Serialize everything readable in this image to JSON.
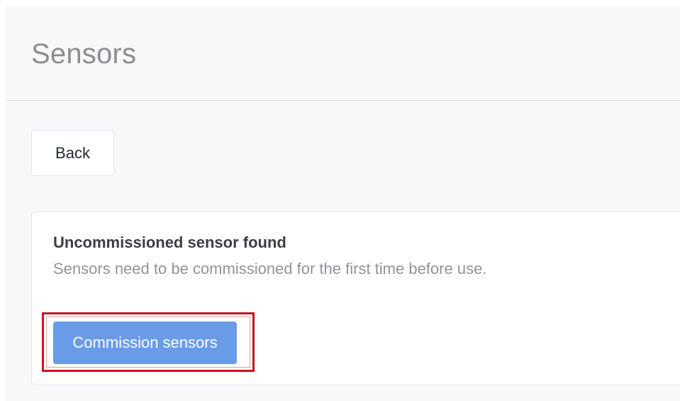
{
  "header": {
    "title": "Sensors"
  },
  "actions": {
    "back_label": "Back"
  },
  "notice": {
    "title": "Uncommissioned sensor found",
    "description": "Sensors need to be commissioned for the first time before use.",
    "button_label": "Commission sensors",
    "button_color": "#6a9be8",
    "highlight_color": "#c8141e"
  }
}
